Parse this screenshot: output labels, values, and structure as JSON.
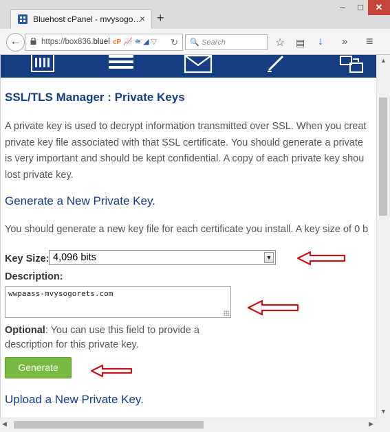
{
  "browser": {
    "tab_title": "Bluehost cPanel - mvysogo…",
    "tab_close": "×",
    "new_tab": "+",
    "url_prefix": "https://box836.",
    "url_host": "bluel",
    "reload_icon": "↻",
    "search_placeholder": "Search",
    "window_min": "–",
    "window_max": "□",
    "window_close": "✕"
  },
  "page": {
    "title": "SSL/TLS Manager : Private Keys",
    "intro_lines": [
      "A private key is used to decrypt information transmitted over SSL. When you creat",
      "private key file associated with that SSL certificate. You should generate a private",
      "is very important and should be kept confidential. A copy of each private key shou",
      "lost private key."
    ],
    "generate_heading": "Generate a New Private Key.",
    "generate_desc": "You should generate a new key file for each certificate you install. A key size of 0 b",
    "key_size_label": "Key Size:",
    "key_size_value": "4,096 bits",
    "description_label": "Description:",
    "description_value": "wwpaass-mvysogorets.com",
    "optional_label": "Optional",
    "optional_line1": ": You can use this field to provide a",
    "optional_line2": "description for this private key.",
    "generate_button": "Generate",
    "upload_heading": "Upload a New Private Key."
  },
  "colors": {
    "heading_blue": "#163d80",
    "button_green": "#79b941",
    "arrow_red": "#c0171d"
  }
}
